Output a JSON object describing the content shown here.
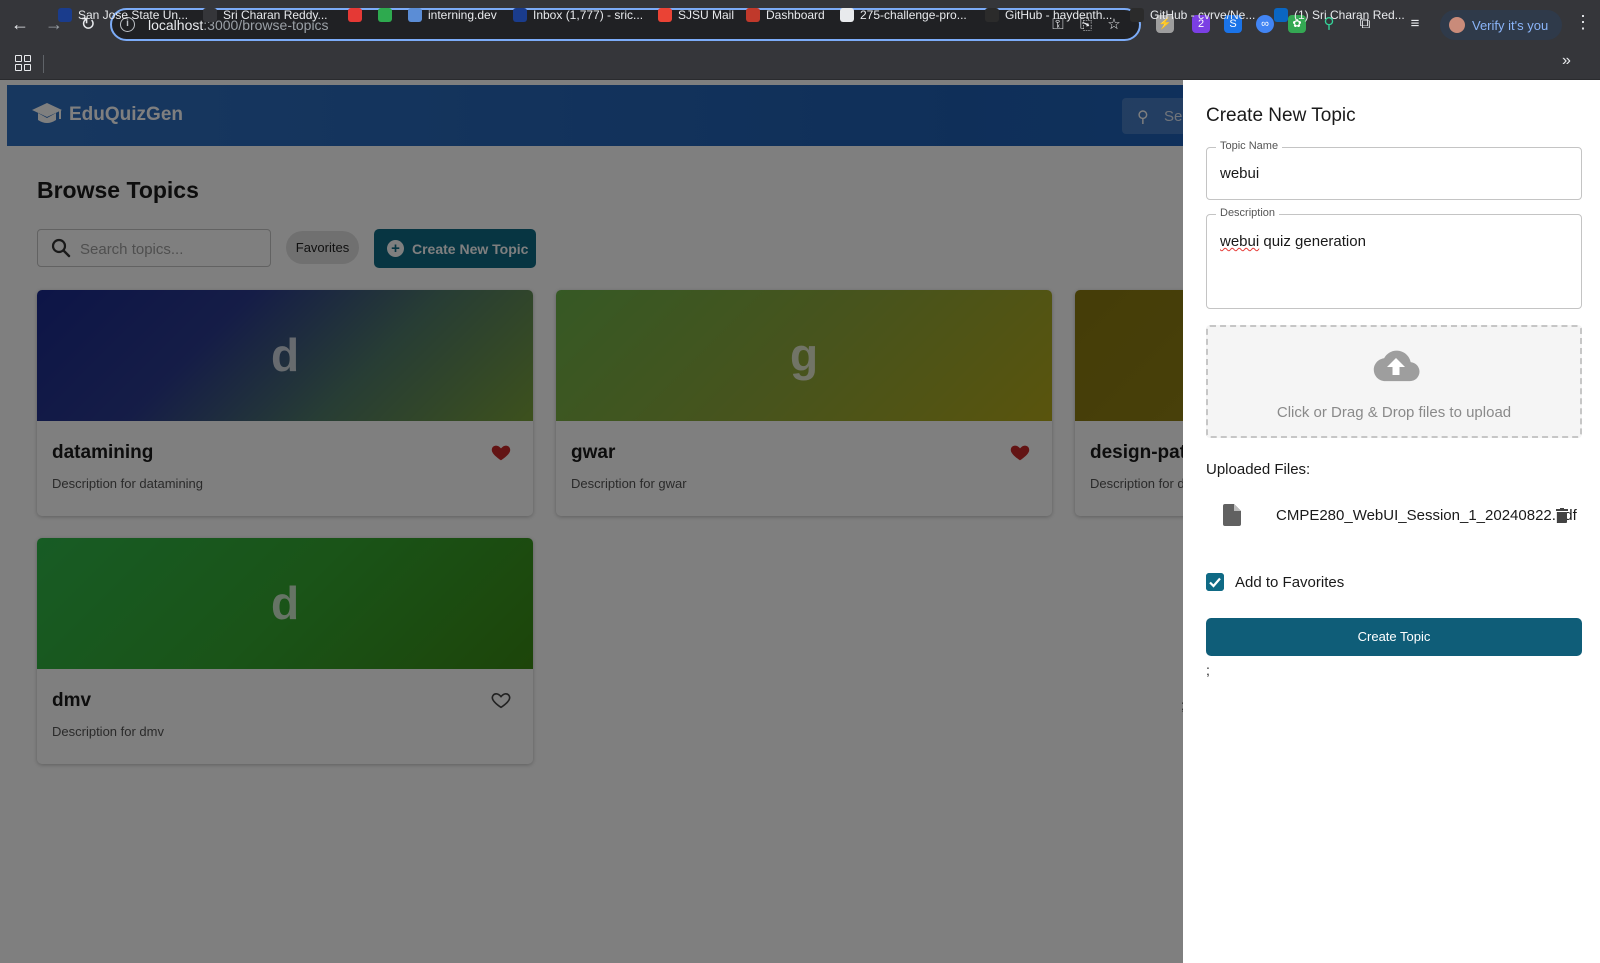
{
  "browser": {
    "url_host": "localhost",
    "url_path": ":3000/browse-topics",
    "verify_label": "Verify it's you",
    "extension_badge": "2",
    "bookmarks": [
      {
        "label": "San Jose State Un...",
        "color": "#1a3c8c"
      },
      {
        "label": "Sri Charan Reddy...",
        "color": "#35363a"
      },
      {
        "label": "",
        "color": "#e53935"
      },
      {
        "label": "",
        "color": "#2eaa4f"
      },
      {
        "label": "interning.dev",
        "color": "#5b8dd6"
      },
      {
        "label": "Inbox (1,777) - sric...",
        "color": "#1a3c8c"
      },
      {
        "label": "SJSU Mail",
        "color": "#ea4335"
      },
      {
        "label": "Dashboard",
        "color": "#c0392b"
      },
      {
        "label": "275-challenge-pro...",
        "color": "#e8eaed"
      },
      {
        "label": "GitHub - haydenth...",
        "color": "#2b2b2b"
      },
      {
        "label": "GitHub - cvrve/Ne...",
        "color": "#2b2b2b"
      },
      {
        "label": "(1) Sri Charan Red...",
        "color": "#0a66c2"
      }
    ]
  },
  "app": {
    "logo_text": "EduQuizGen",
    "header_search_text": "Se",
    "page_title": "Browse Topics",
    "search_placeholder": "Search topics...",
    "favorites_chip": "Favorites",
    "create_button": "Create New Topic",
    "cards": [
      {
        "letter": "d",
        "title": "datamining",
        "description": "Description for datamining",
        "favorite": true,
        "gradient": "linear-gradient(135deg, #1a2a8e 0%, #2b3a8f 35%, #4f7a6a 65%, #7aa23a 100%)"
      },
      {
        "letter": "g",
        "title": "gwar",
        "description": "Description for gwar",
        "favorite": true,
        "gradient": "linear-gradient(135deg, #6cb24a 0%, #8fa83a 50%, #b3a81a 100%)"
      },
      {
        "letter": "d",
        "title": "design-pat",
        "description": "Description for d",
        "favorite": false,
        "gradient": "linear-gradient(135deg, #8a7a10 0%, #9a8a1a 100%)"
      },
      {
        "letter": "d",
        "title": "dmv",
        "description": "Description for dmv",
        "favorite": false,
        "gradient": "linear-gradient(135deg, #2fb84a 0%, #34a830 50%, #3a8a14 100%)"
      }
    ]
  },
  "drawer": {
    "title": "Create New Topic",
    "topic_name_label": "Topic Name",
    "topic_name_value": "webui",
    "description_label": "Description",
    "description_word1": "webui",
    "description_rest": " quiz generation",
    "dropzone_text": "Click or Drag & Drop files to upload",
    "uploaded_label": "Uploaded Files:",
    "uploaded_file": "CMPE280_WebUI_Session_1_20240822.pdf",
    "favorites_checkbox_label": "Add to Favorites",
    "favorites_checked": true,
    "submit_button": "Create Topic",
    "stray_semicolon_1": ";",
    "stray_semicolon_2": ";"
  },
  "colors": {
    "accent": "#0f6a85",
    "header_blue": "#1f5fb3",
    "heart_red": "#c62828"
  }
}
